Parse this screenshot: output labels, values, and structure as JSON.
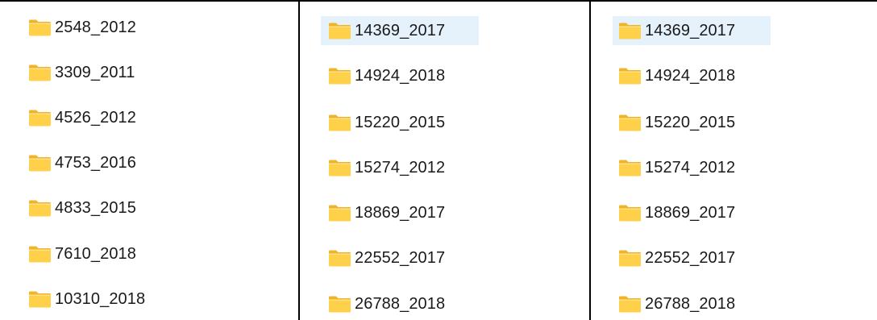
{
  "columns": [
    {
      "items": [
        {
          "name": "2548_2012",
          "selected": false
        },
        {
          "name": "3309_2011",
          "selected": false
        },
        {
          "name": "4526_2012",
          "selected": false
        },
        {
          "name": "4753_2016",
          "selected": false
        },
        {
          "name": "4833_2015",
          "selected": false
        },
        {
          "name": "7610_2018",
          "selected": false
        },
        {
          "name": "10310_2018",
          "selected": false
        }
      ]
    },
    {
      "items": [
        {
          "name": "14369_2017",
          "selected": true
        },
        {
          "name": "14924_2018",
          "selected": false
        },
        {
          "name": "15220_2015",
          "selected": false
        },
        {
          "name": "15274_2012",
          "selected": false
        },
        {
          "name": "18869_2017",
          "selected": false
        },
        {
          "name": "22552_2017",
          "selected": false
        },
        {
          "name": "26788_2018",
          "selected": false
        }
      ]
    },
    {
      "items": [
        {
          "name": "14369_2017",
          "selected": true
        },
        {
          "name": "14924_2018",
          "selected": false
        },
        {
          "name": "15220_2015",
          "selected": false
        },
        {
          "name": "15274_2012",
          "selected": false
        },
        {
          "name": "18869_2017",
          "selected": false
        },
        {
          "name": "22552_2017",
          "selected": false
        },
        {
          "name": "26788_2018",
          "selected": false
        }
      ]
    }
  ],
  "icon": "folder-icon",
  "colors": {
    "folder_body": "#ffd04a",
    "folder_tab": "#f0b429",
    "selection": "#e5f1fb",
    "divider": "#000000"
  }
}
